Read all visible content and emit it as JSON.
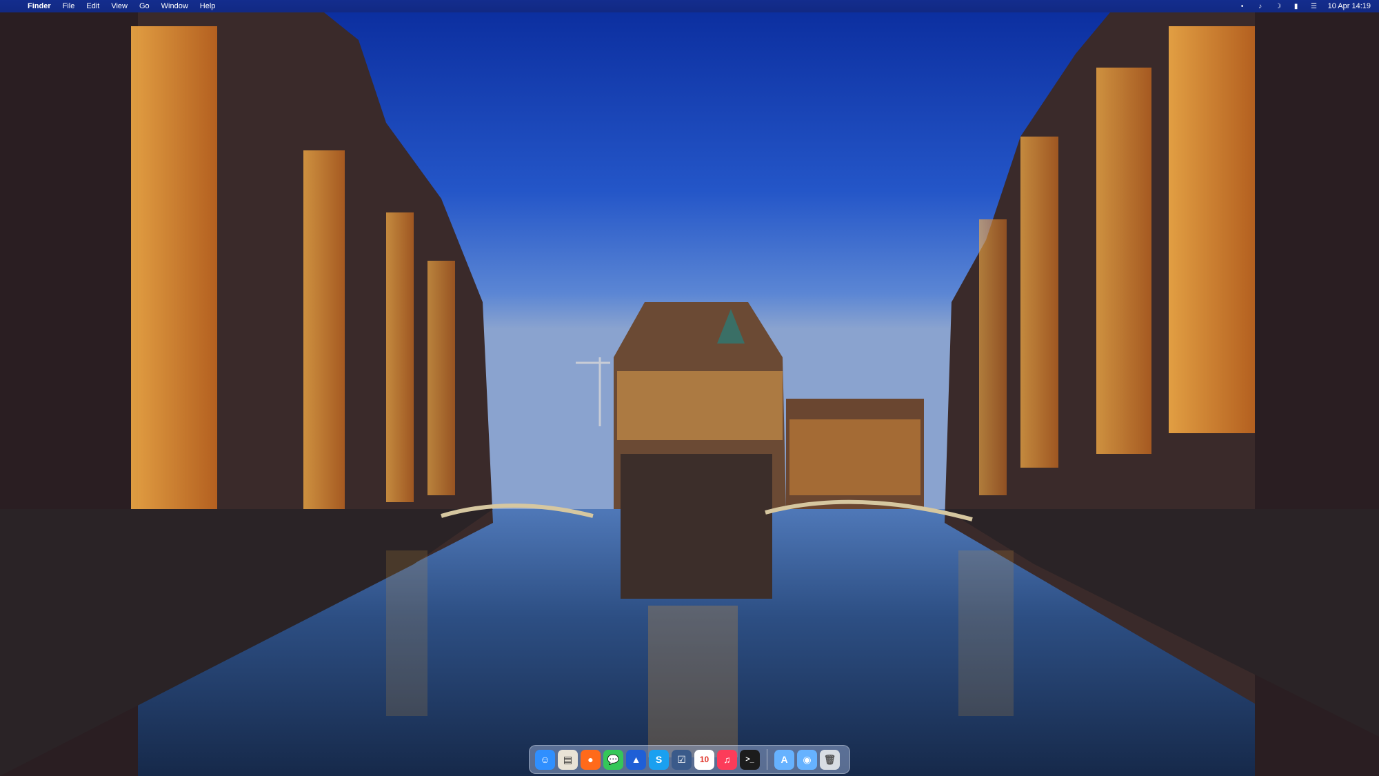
{
  "menubar": {
    "apple_icon": "apple-logo-icon",
    "app_name": "Finder",
    "menus": [
      "File",
      "Edit",
      "View",
      "Go",
      "Window",
      "Help"
    ],
    "status_icons": [
      "dot-icon",
      "music-note-icon",
      "moon-icon",
      "battery-icon",
      "control-center-icon"
    ],
    "clock": "10 Apr  14:19"
  },
  "dock": {
    "apps": [
      {
        "name": "finder",
        "icon": "finder-icon",
        "glyph": "☺",
        "color": "#2f8fff"
      },
      {
        "name": "preview",
        "icon": "preview-icon",
        "glyph": "▤",
        "color": "#e9e3d6"
      },
      {
        "name": "firefox",
        "icon": "firefox-icon",
        "glyph": "●",
        "color": "#ff6a1a"
      },
      {
        "name": "messages",
        "icon": "messages-icon",
        "glyph": "💬",
        "color": "#34c759"
      },
      {
        "name": "navigation",
        "icon": "navigation-arrow-icon",
        "glyph": "▲",
        "color": "#1f5fd6"
      },
      {
        "name": "skype",
        "icon": "skype-icon",
        "glyph": "S",
        "color": "#1aa0f0"
      },
      {
        "name": "tasks",
        "icon": "checklist-icon",
        "glyph": "☑",
        "color": "#3a5a8a"
      },
      {
        "name": "calendar",
        "icon": "calendar-icon",
        "glyph": "10",
        "color": "#ffffff"
      },
      {
        "name": "music",
        "icon": "music-icon",
        "glyph": "♫",
        "color": "#fc3c5a"
      },
      {
        "name": "terminal",
        "icon": "terminal-icon",
        "glyph": ">_",
        "color": "#1c1c1c"
      }
    ],
    "others": [
      {
        "name": "applications-folder",
        "icon": "applications-folder-icon",
        "glyph": "A",
        "color": "#66b2ff"
      },
      {
        "name": "downloads-folder",
        "icon": "downloads-folder-icon",
        "glyph": "◉",
        "color": "#66b2ff"
      },
      {
        "name": "trash",
        "icon": "trash-icon",
        "glyph": "🗑",
        "color": "#d8dde3"
      }
    ]
  }
}
